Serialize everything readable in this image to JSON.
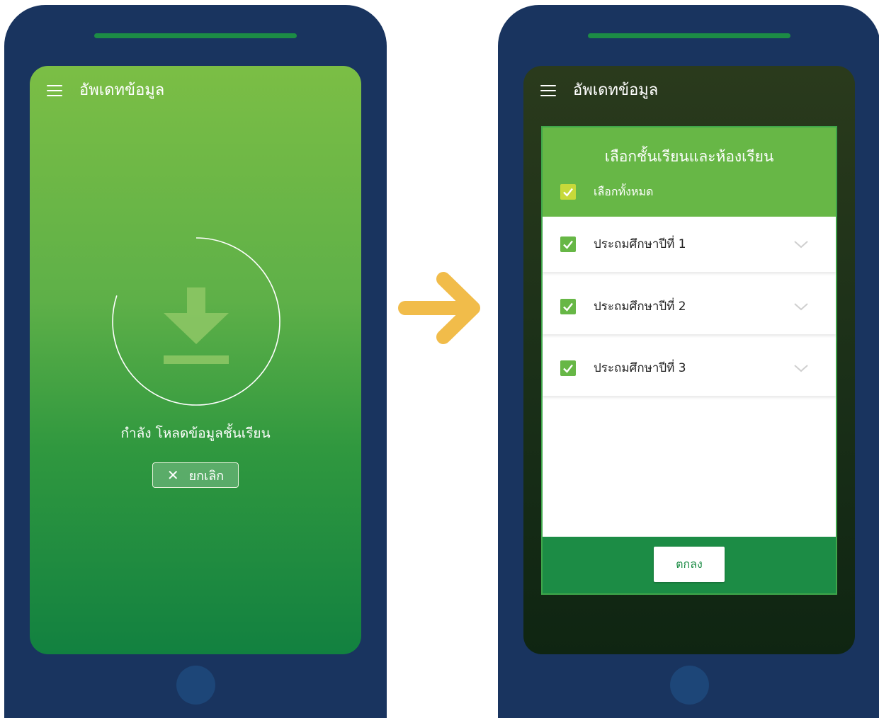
{
  "colors": {
    "phone_body": "#19345f",
    "speaker": "#1c8c45",
    "accent_green": "#67b746",
    "dark_green": "#1c8c45",
    "arrow": "#f1bc4a",
    "select_all_check": "#c7d93a"
  },
  "left_screen": {
    "appbar": {
      "menu_icon": "hamburger-icon",
      "title": "อัพเดทข้อมูล"
    },
    "loading": {
      "icon": "download-icon",
      "progress_fraction": 0.8,
      "text": "กำลัง โหลดข้อมูลชั้นเรียน"
    },
    "cancel_button": {
      "icon": "close-icon",
      "label": "ยกเลิก"
    }
  },
  "transition": {
    "icon": "arrow-right-icon"
  },
  "right_screen": {
    "appbar": {
      "menu_icon": "hamburger-icon",
      "title": "อัพเดทข้อมูล"
    },
    "dialog": {
      "title": "เลือกชั้นเรียนและห้องเรียน",
      "select_all": {
        "label": "เลือกทั้งหมด",
        "checked": true
      },
      "grades": [
        {
          "label": "ประถมศึกษาปีที่ 1",
          "checked": true,
          "expand_icon": "chevron-down-icon"
        },
        {
          "label": "ประถมศึกษาปีที่ 2",
          "checked": true,
          "expand_icon": "chevron-down-icon"
        },
        {
          "label": "ประถมศึกษาปีที่ 3",
          "checked": true,
          "expand_icon": "chevron-down-icon"
        }
      ],
      "ok_button": {
        "label": "ตกลง"
      }
    }
  }
}
